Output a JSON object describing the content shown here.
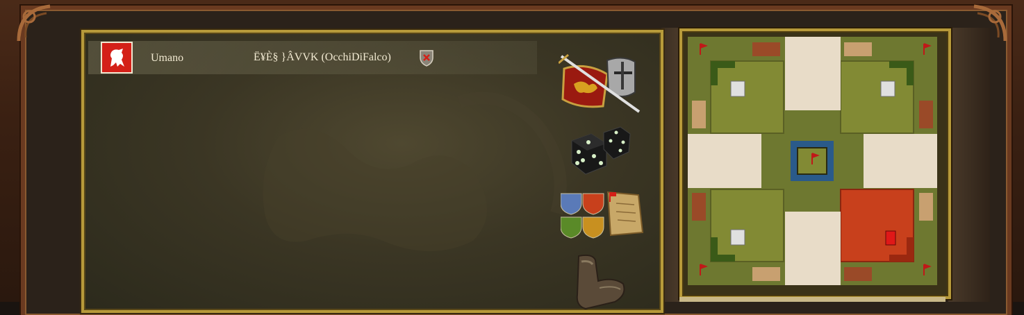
{
  "lobby": {
    "player": {
      "faction": "Umano",
      "nickname": "Ë¥È§ }ÂVVK (OcchiDiFalco)"
    },
    "icons": {
      "crest": "red-lion-crest-icon",
      "kick": "red-x-shield-icon",
      "game_settings": "sword-shield-helmet-icon",
      "dice": "dice-icon",
      "teams": "team-shields-scroll-icon",
      "boot": "boot-icon"
    },
    "map": {
      "colors": {
        "grass": "#6e7830",
        "plot": "#8a8a38",
        "road": "#e8dcc8",
        "player_zone": "#c8401c",
        "castle": "#e8e8e8",
        "moat": "#2a5a8a"
      }
    }
  }
}
